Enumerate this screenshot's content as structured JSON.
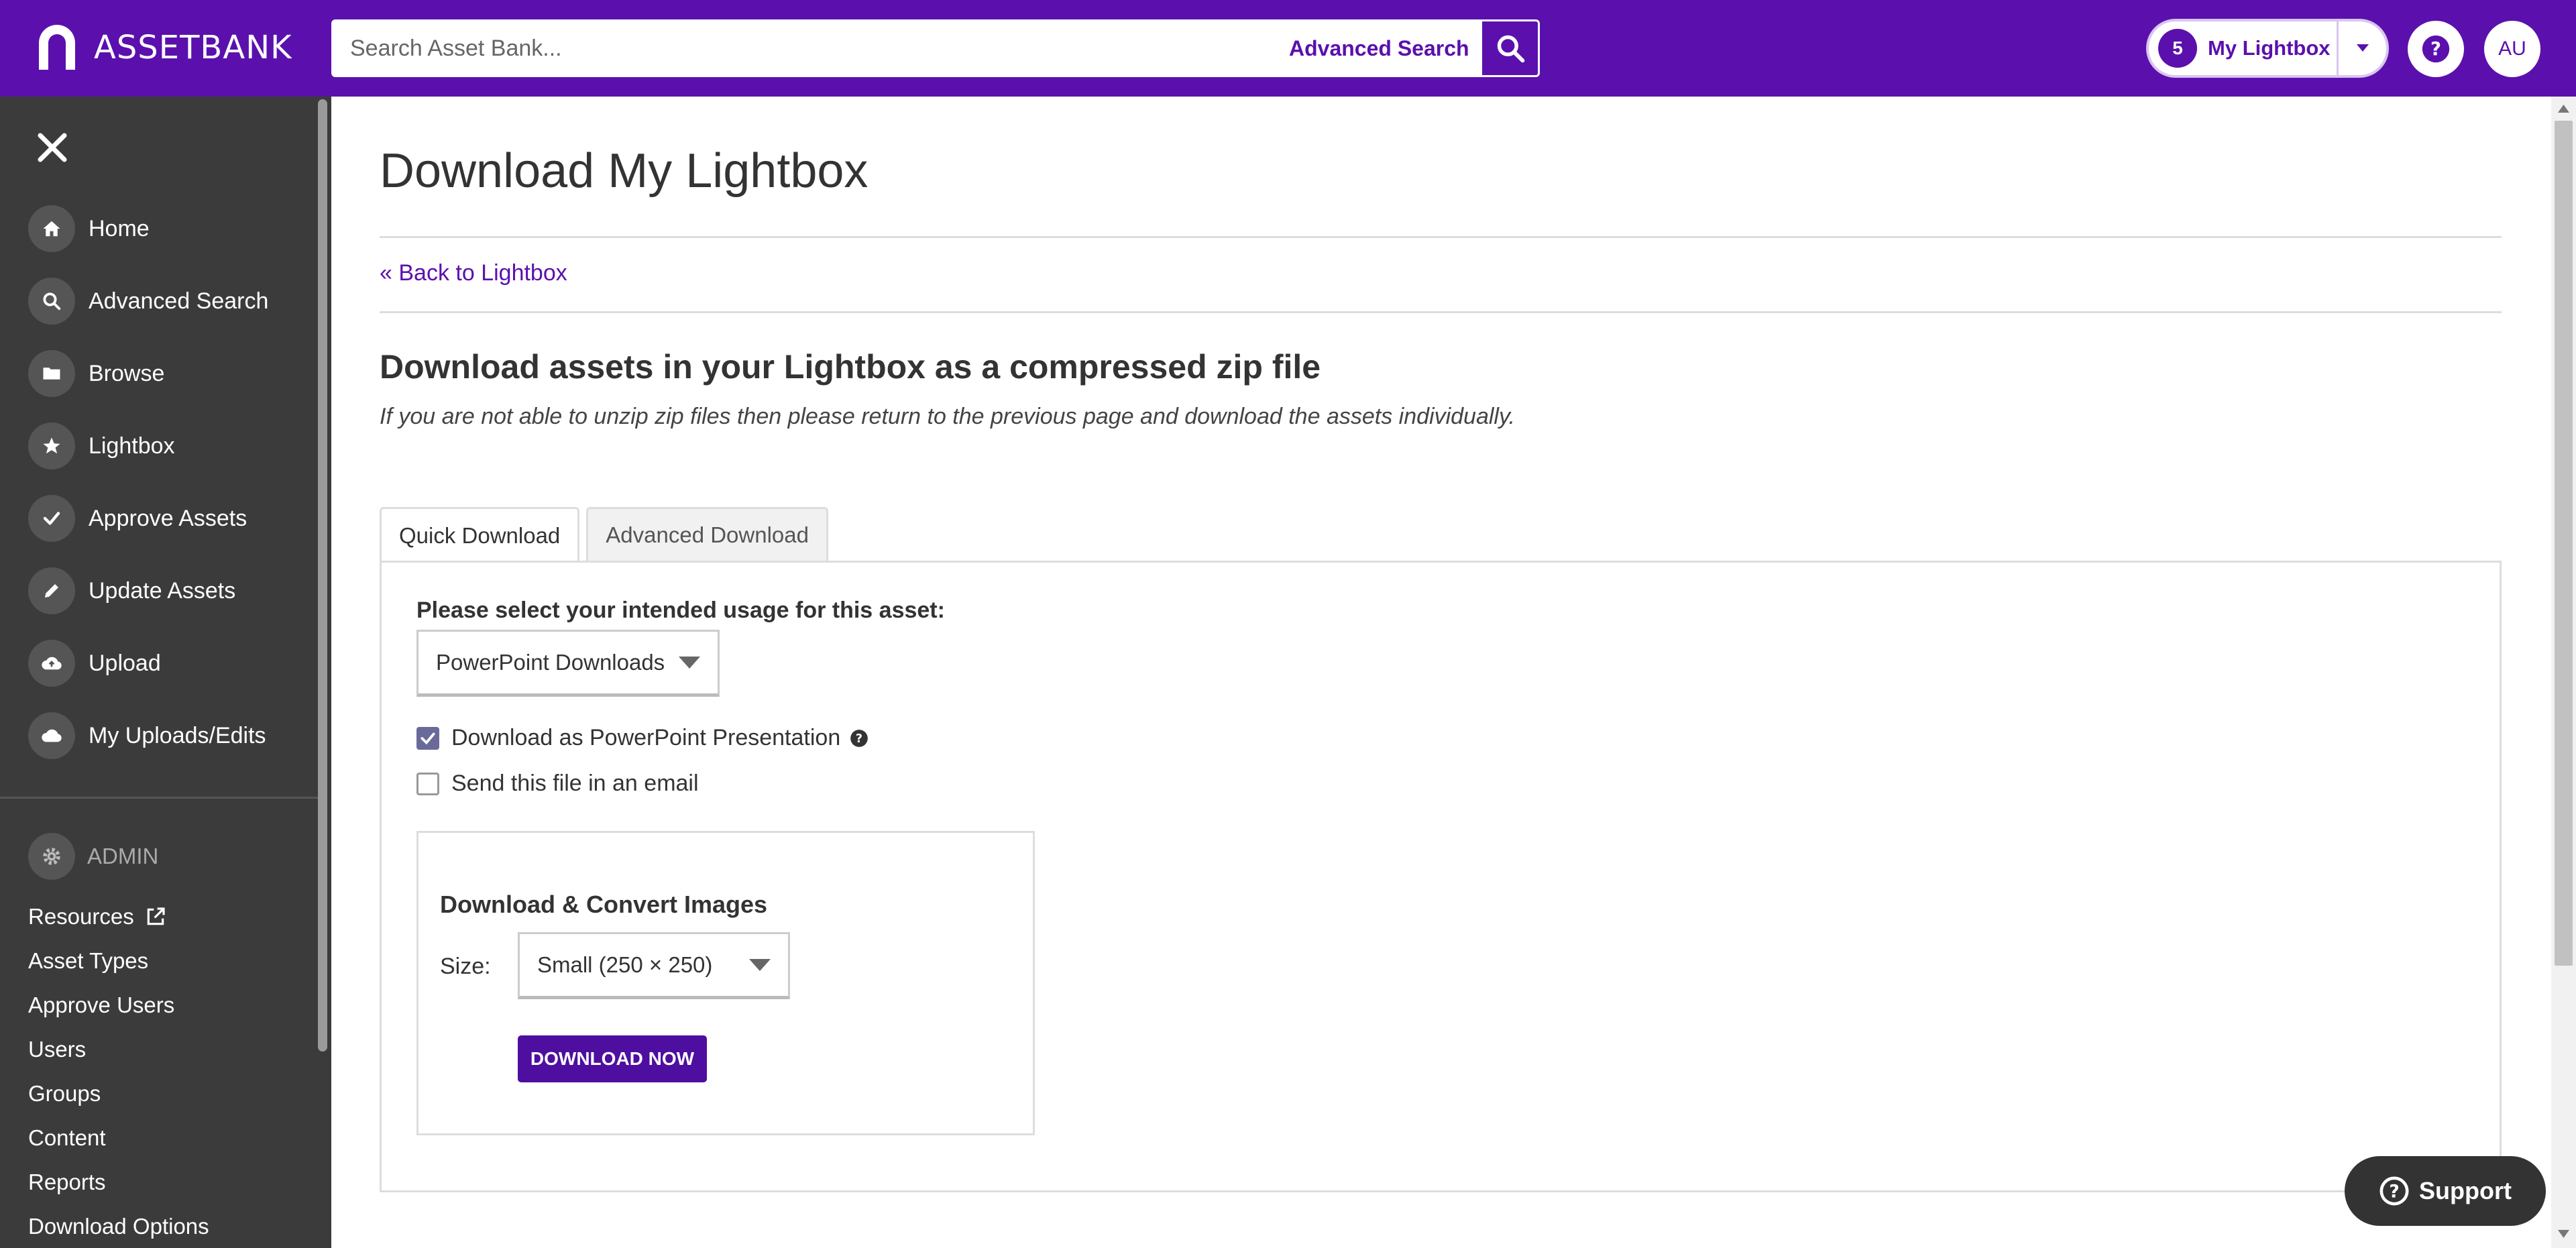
{
  "header": {
    "logo_text": "ASSETBANK",
    "search_placeholder": "Search Asset Bank...",
    "advanced_search": "Advanced Search",
    "lightbox_count": "5",
    "lightbox_label": "My Lightbox",
    "avatar_initials": "AU",
    "brand_color": "#5b10ad"
  },
  "sidebar": {
    "items": [
      {
        "label": "Home",
        "icon": "home-icon"
      },
      {
        "label": "Advanced Search",
        "icon": "search-icon"
      },
      {
        "label": "Browse",
        "icon": "folder-icon"
      },
      {
        "label": "Lightbox",
        "icon": "star-icon"
      },
      {
        "label": "Approve Assets",
        "icon": "check-icon"
      },
      {
        "label": "Update Assets",
        "icon": "pencil-icon"
      },
      {
        "label": "Upload",
        "icon": "cloud-upload-icon"
      },
      {
        "label": "My Uploads/Edits",
        "icon": "cloud-icon"
      }
    ],
    "admin_label": "ADMIN",
    "admin_links": [
      "Resources",
      "Asset Types",
      "Approve Users",
      "Users",
      "Groups",
      "Content",
      "Reports",
      "Download Options"
    ]
  },
  "main": {
    "title": "Download My Lightbox",
    "back_link": "« Back to Lightbox",
    "subtitle": "Download assets in your Lightbox as a compressed zip file",
    "note": "If you are not able to unzip zip files then please return to the previous page and download the assets individually.",
    "tabs": [
      "Quick Download",
      "Advanced Download"
    ],
    "usage_label": "Please select your intended usage for this asset:",
    "usage_value": "PowerPoint Downloads",
    "cb_ppt": "Download as PowerPoint Presentation",
    "cb_email": "Send this file in an email",
    "convert_title": "Download & Convert Images",
    "size_label": "Size:",
    "size_value": "Small (250 × 250)",
    "download_button": "DOWNLOAD NOW"
  },
  "support_label": "Support"
}
